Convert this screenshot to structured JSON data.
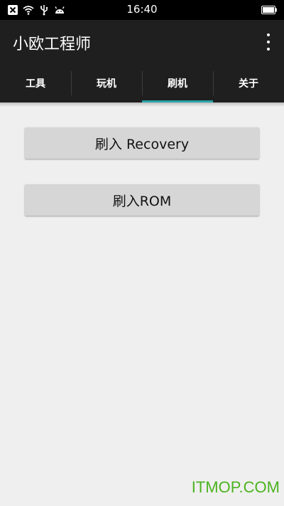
{
  "status_bar": {
    "time": "16:40",
    "icons": [
      "close-box-icon",
      "wifi-icon",
      "usb-icon",
      "android-icon",
      "battery-icon"
    ]
  },
  "app_bar": {
    "title": "小欧工程师",
    "menu_icon": "overflow-menu-icon"
  },
  "tabs": [
    {
      "label": "工具"
    },
    {
      "label": "玩机"
    },
    {
      "label": "刷机"
    },
    {
      "label": "关于"
    }
  ],
  "active_tab_index": 2,
  "accent_color": "#2aa2a8",
  "buttons": {
    "flash_recovery": "刷入 Recovery",
    "flash_rom": "刷入ROM"
  },
  "watermark": "ITMOP.COM"
}
